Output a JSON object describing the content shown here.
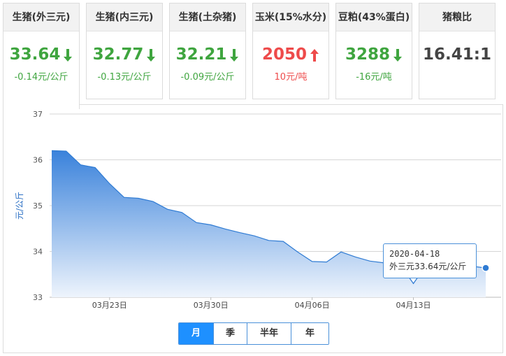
{
  "cards": [
    {
      "title": "生猪(外三元)",
      "value": "33.64",
      "direction": "down",
      "change": "-0.14元/公斤",
      "color": "#3fa53f"
    },
    {
      "title": "生猪(内三元)",
      "value": "32.77",
      "direction": "down",
      "change": "-0.13元/公斤",
      "color": "#3fa53f"
    },
    {
      "title": "生猪(土杂猪)",
      "value": "32.21",
      "direction": "down",
      "change": "-0.09元/公斤",
      "color": "#3fa53f"
    },
    {
      "title": "玉米(15%水分)",
      "value": "2050",
      "direction": "up",
      "change": "10元/吨",
      "color": "#ee4b4b"
    },
    {
      "title": "豆粕(43%蛋白)",
      "value": "3288",
      "direction": "down",
      "change": "-16元/吨",
      "color": "#3fa53f"
    },
    {
      "title": "猪粮比",
      "value": "16.41:1",
      "direction": "none",
      "change": "",
      "color": "#444444"
    }
  ],
  "active_card_index": 0,
  "tooltip": {
    "date": "2020-04-18",
    "text": "外三元33.64元/公斤"
  },
  "range_tabs": [
    {
      "label": "月",
      "selected": true
    },
    {
      "label": "季",
      "selected": false
    },
    {
      "label": "半年",
      "selected": false
    },
    {
      "label": "年",
      "selected": false
    }
  ],
  "chart_data": {
    "type": "area",
    "title": "",
    "xlabel": "",
    "ylabel": "元/公斤",
    "ylim": [
      33,
      37
    ],
    "yticks": [
      33,
      34,
      35,
      36,
      37
    ],
    "xtick_labels": [
      {
        "label": "03月23日",
        "index": 4
      },
      {
        "label": "03月30日",
        "index": 11
      },
      {
        "label": "04月06日",
        "index": 18
      },
      {
        "label": "04月13日",
        "index": 25
      }
    ],
    "grid": true,
    "colors": {
      "line": "#2f7bd3",
      "fill_top": "#3a82db",
      "fill_bottom": "#eef4fc",
      "marker": "#2f7bd3"
    },
    "series": [
      {
        "x": [
          "2020-03-19",
          "2020-03-20",
          "2020-03-21",
          "2020-03-22",
          "2020-03-23",
          "2020-03-24",
          "2020-03-25",
          "2020-03-26",
          "2020-03-27",
          "2020-03-28",
          "2020-03-29",
          "2020-03-30",
          "2020-03-31",
          "2020-04-01",
          "2020-04-02",
          "2020-04-03",
          "2020-04-04",
          "2020-04-05",
          "2020-04-06",
          "2020-04-07",
          "2020-04-08",
          "2020-04-09",
          "2020-04-10",
          "2020-04-11",
          "2020-04-12",
          "2020-04-13",
          "2020-04-14",
          "2020-04-15",
          "2020-04-16",
          "2020-04-17",
          "2020-04-18"
        ],
        "values": [
          36.2,
          36.19,
          35.89,
          35.83,
          35.48,
          35.18,
          35.16,
          35.09,
          34.92,
          34.85,
          34.63,
          34.58,
          34.49,
          34.41,
          34.34,
          34.24,
          34.22,
          33.99,
          33.78,
          33.77,
          33.99,
          33.88,
          33.79,
          33.75,
          33.75,
          33.3,
          33.75,
          33.76,
          33.73,
          33.68,
          33.64
        ]
      }
    ]
  }
}
